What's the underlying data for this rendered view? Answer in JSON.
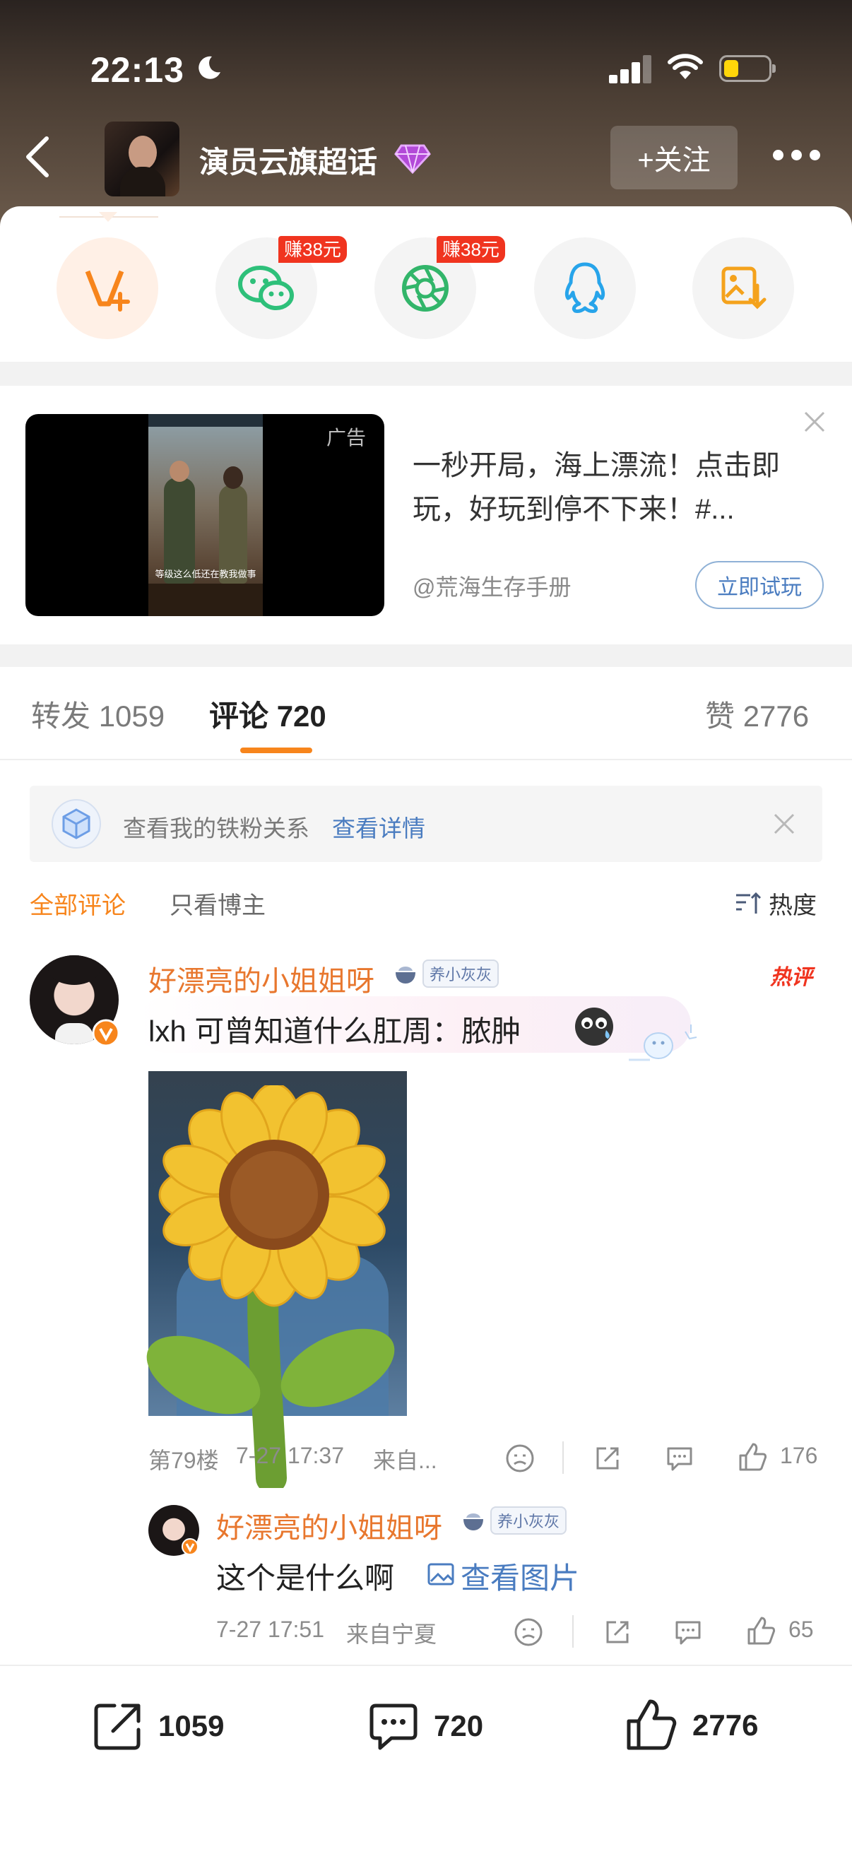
{
  "status_bar": {
    "time": "22:13"
  },
  "header": {
    "title": "演员云旗超话",
    "follow_label": "+关注"
  },
  "share": {
    "earn_tag_1": "赚38元",
    "earn_tag_2": "赚38元"
  },
  "ad": {
    "corner_label": "广告",
    "video_caption": "等级这么低还在教我做事",
    "text": "一秒开局，海上漂流！点击即玩，好玩到停不下来！#...",
    "source": "@荒海生存手册",
    "cta": "立即试玩"
  },
  "tabs": {
    "repost_label": "转发",
    "repost_count": "1059",
    "comments_label": "评论",
    "comments_count": "720",
    "likes_label": "赞",
    "likes_count": "2776"
  },
  "fans_banner": {
    "text": "查看我的铁粉关系",
    "link": "查看详情"
  },
  "filters": {
    "all": "全部评论",
    "author_only": "只看博主",
    "sort": "热度"
  },
  "comment": {
    "user": "好漂亮的小姐姐呀",
    "badge": "养小灰灰",
    "hot_tag": "热评",
    "text": "lxh 可曾知道什么肛周：脓肿",
    "floor": "第79楼",
    "time": "7-27 17:37",
    "from": "来自...",
    "likes": "176"
  },
  "reply": {
    "user": "好漂亮的小姐姐呀",
    "badge": "养小灰灰",
    "text": "这个是什么啊",
    "view_pic": "查看图片",
    "time": "7-27 17:51",
    "from": "来自宁夏",
    "likes": "65"
  },
  "bottom_bar": {
    "reposts": "1059",
    "comments": "720",
    "likes": "2776"
  },
  "colors": {
    "accent": "#f7851c",
    "link": "#4a7cc0",
    "username": "#e8772e",
    "hot": "#f0341f"
  }
}
